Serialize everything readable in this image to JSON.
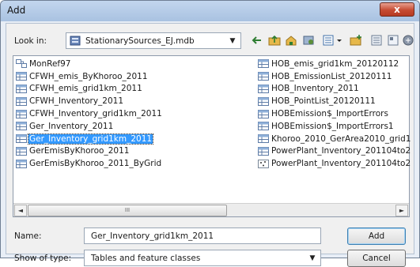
{
  "window": {
    "title": "Add",
    "close_glyph": "x"
  },
  "lookin": {
    "label": "Look in:",
    "value": "StationarySources_EJ.mdb",
    "icon": "database-icon"
  },
  "toolbar": [
    {
      "name": "back-icon"
    },
    {
      "name": "up-folder-icon"
    },
    {
      "name": "home-icon"
    },
    {
      "name": "connect-folder-icon"
    },
    {
      "name": "view-options-icon"
    },
    {
      "name": "new-folder-icon"
    },
    {
      "name": "list-view-icon"
    },
    {
      "name": "details-view-icon"
    },
    {
      "name": "catalog-icon"
    }
  ],
  "files_col1": [
    {
      "label": "MonRef97",
      "icon": "relationship-icon"
    },
    {
      "label": "CFWH_emis_ByKhoroo_2011",
      "icon": "table-icon"
    },
    {
      "label": "CFWH_emis_grid1km_2011",
      "icon": "table-icon"
    },
    {
      "label": "CFWH_Inventory_2011",
      "icon": "table-icon"
    },
    {
      "label": "CFWH_Inventory_grid1km_2011",
      "icon": "table-icon"
    },
    {
      "label": "Ger_Inventory_2011",
      "icon": "table-icon"
    },
    {
      "label": "Ger_Inventory_grid1km_2011",
      "icon": "table-icon",
      "selected": true
    },
    {
      "label": "GerEmisByKhoroo_2011",
      "icon": "table-icon"
    },
    {
      "label": "GerEmisByKhoroo_2011_ByGrid",
      "icon": "table-icon"
    }
  ],
  "files_col2": [
    {
      "label": "HOB_emis_grid1km_20120112",
      "icon": "table-icon"
    },
    {
      "label": "HOB_EmissionList_20120111",
      "icon": "table-icon"
    },
    {
      "label": "HOB_Inventory_2011",
      "icon": "table-icon"
    },
    {
      "label": "HOB_PointList_20120111",
      "icon": "table-icon"
    },
    {
      "label": "HOBEmission$_ImportErrors",
      "icon": "table-icon"
    },
    {
      "label": "HOBEmission$_ImportErrors1",
      "icon": "table-icon"
    },
    {
      "label": "Khoroo_2010_GerArea2010_grid1",
      "icon": "table-icon"
    },
    {
      "label": "PowerPlant_Inventory_201104to2",
      "icon": "table-icon"
    },
    {
      "label": "PowerPlant_Inventory_201104to2",
      "icon": "point-feature-icon"
    }
  ],
  "scrollbar": {
    "left_glyph": "◄",
    "right_glyph": "►",
    "thumb_grip": "III"
  },
  "name_field": {
    "label": "Name:",
    "value": "Ger_Inventory_grid1km_2011"
  },
  "type_field": {
    "label": "Show of type:",
    "value": "Tables and feature classes"
  },
  "buttons": {
    "add": "Add",
    "cancel": "Cancel"
  },
  "colors": {
    "selection": "#3399ff",
    "titlebar": "#b5cce8",
    "close": "#c64b32"
  }
}
